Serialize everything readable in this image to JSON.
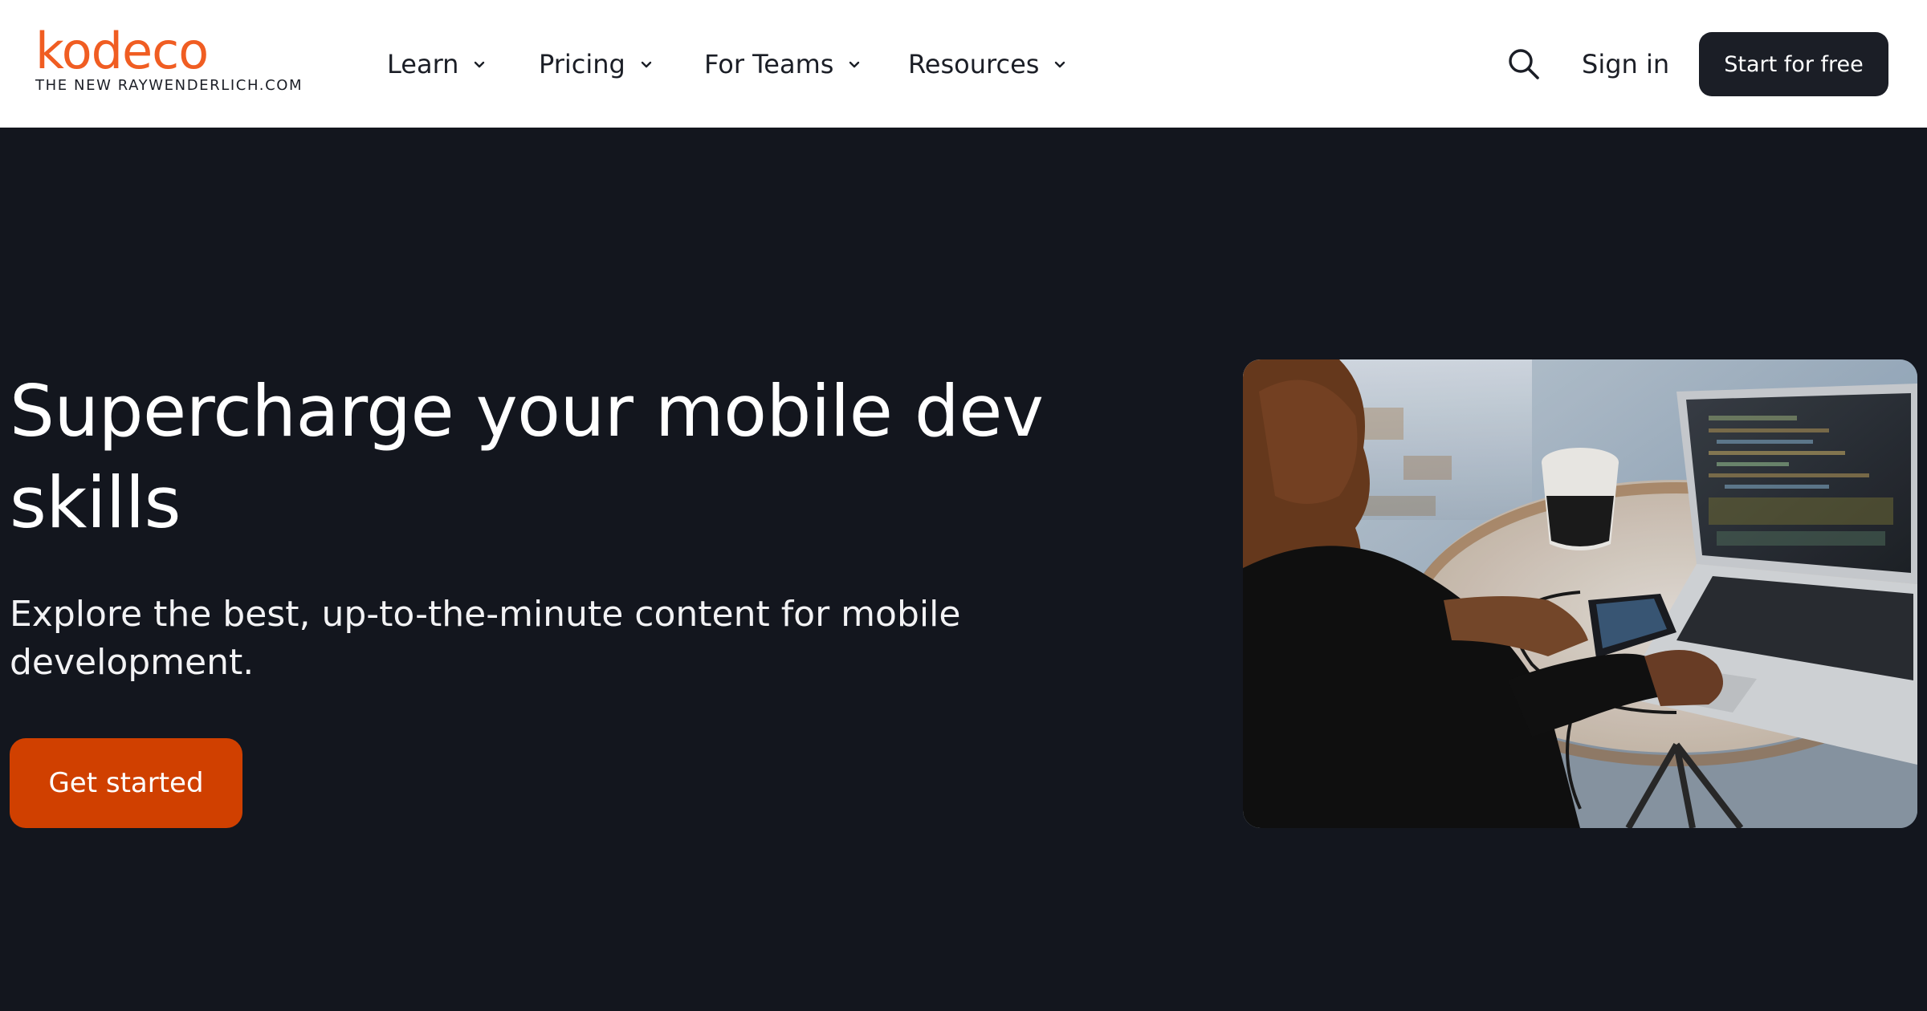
{
  "logo": {
    "wordmark": "kodeco",
    "tagline": "THE NEW RAYWENDERLICH.COM"
  },
  "nav": {
    "items": [
      {
        "label": "Learn"
      },
      {
        "label": "Pricing"
      },
      {
        "label": "For Teams"
      },
      {
        "label": "Resources"
      }
    ]
  },
  "header_actions": {
    "search_icon": "search-icon",
    "signin_label": "Sign in",
    "start_label": "Start for free"
  },
  "hero": {
    "title": "Supercharge your mobile dev skills",
    "subtitle": "Explore the best, up-to-the-minute content for mobile development.",
    "cta_label": "Get started",
    "image": "person-using-laptop-and-phone-photo"
  },
  "colors": {
    "brand_orange": "#f05d22",
    "cta_orange": "#d04000",
    "dark_bg": "#13161e",
    "dark_button": "#1b1e26",
    "header_bg": "#ffffff"
  }
}
